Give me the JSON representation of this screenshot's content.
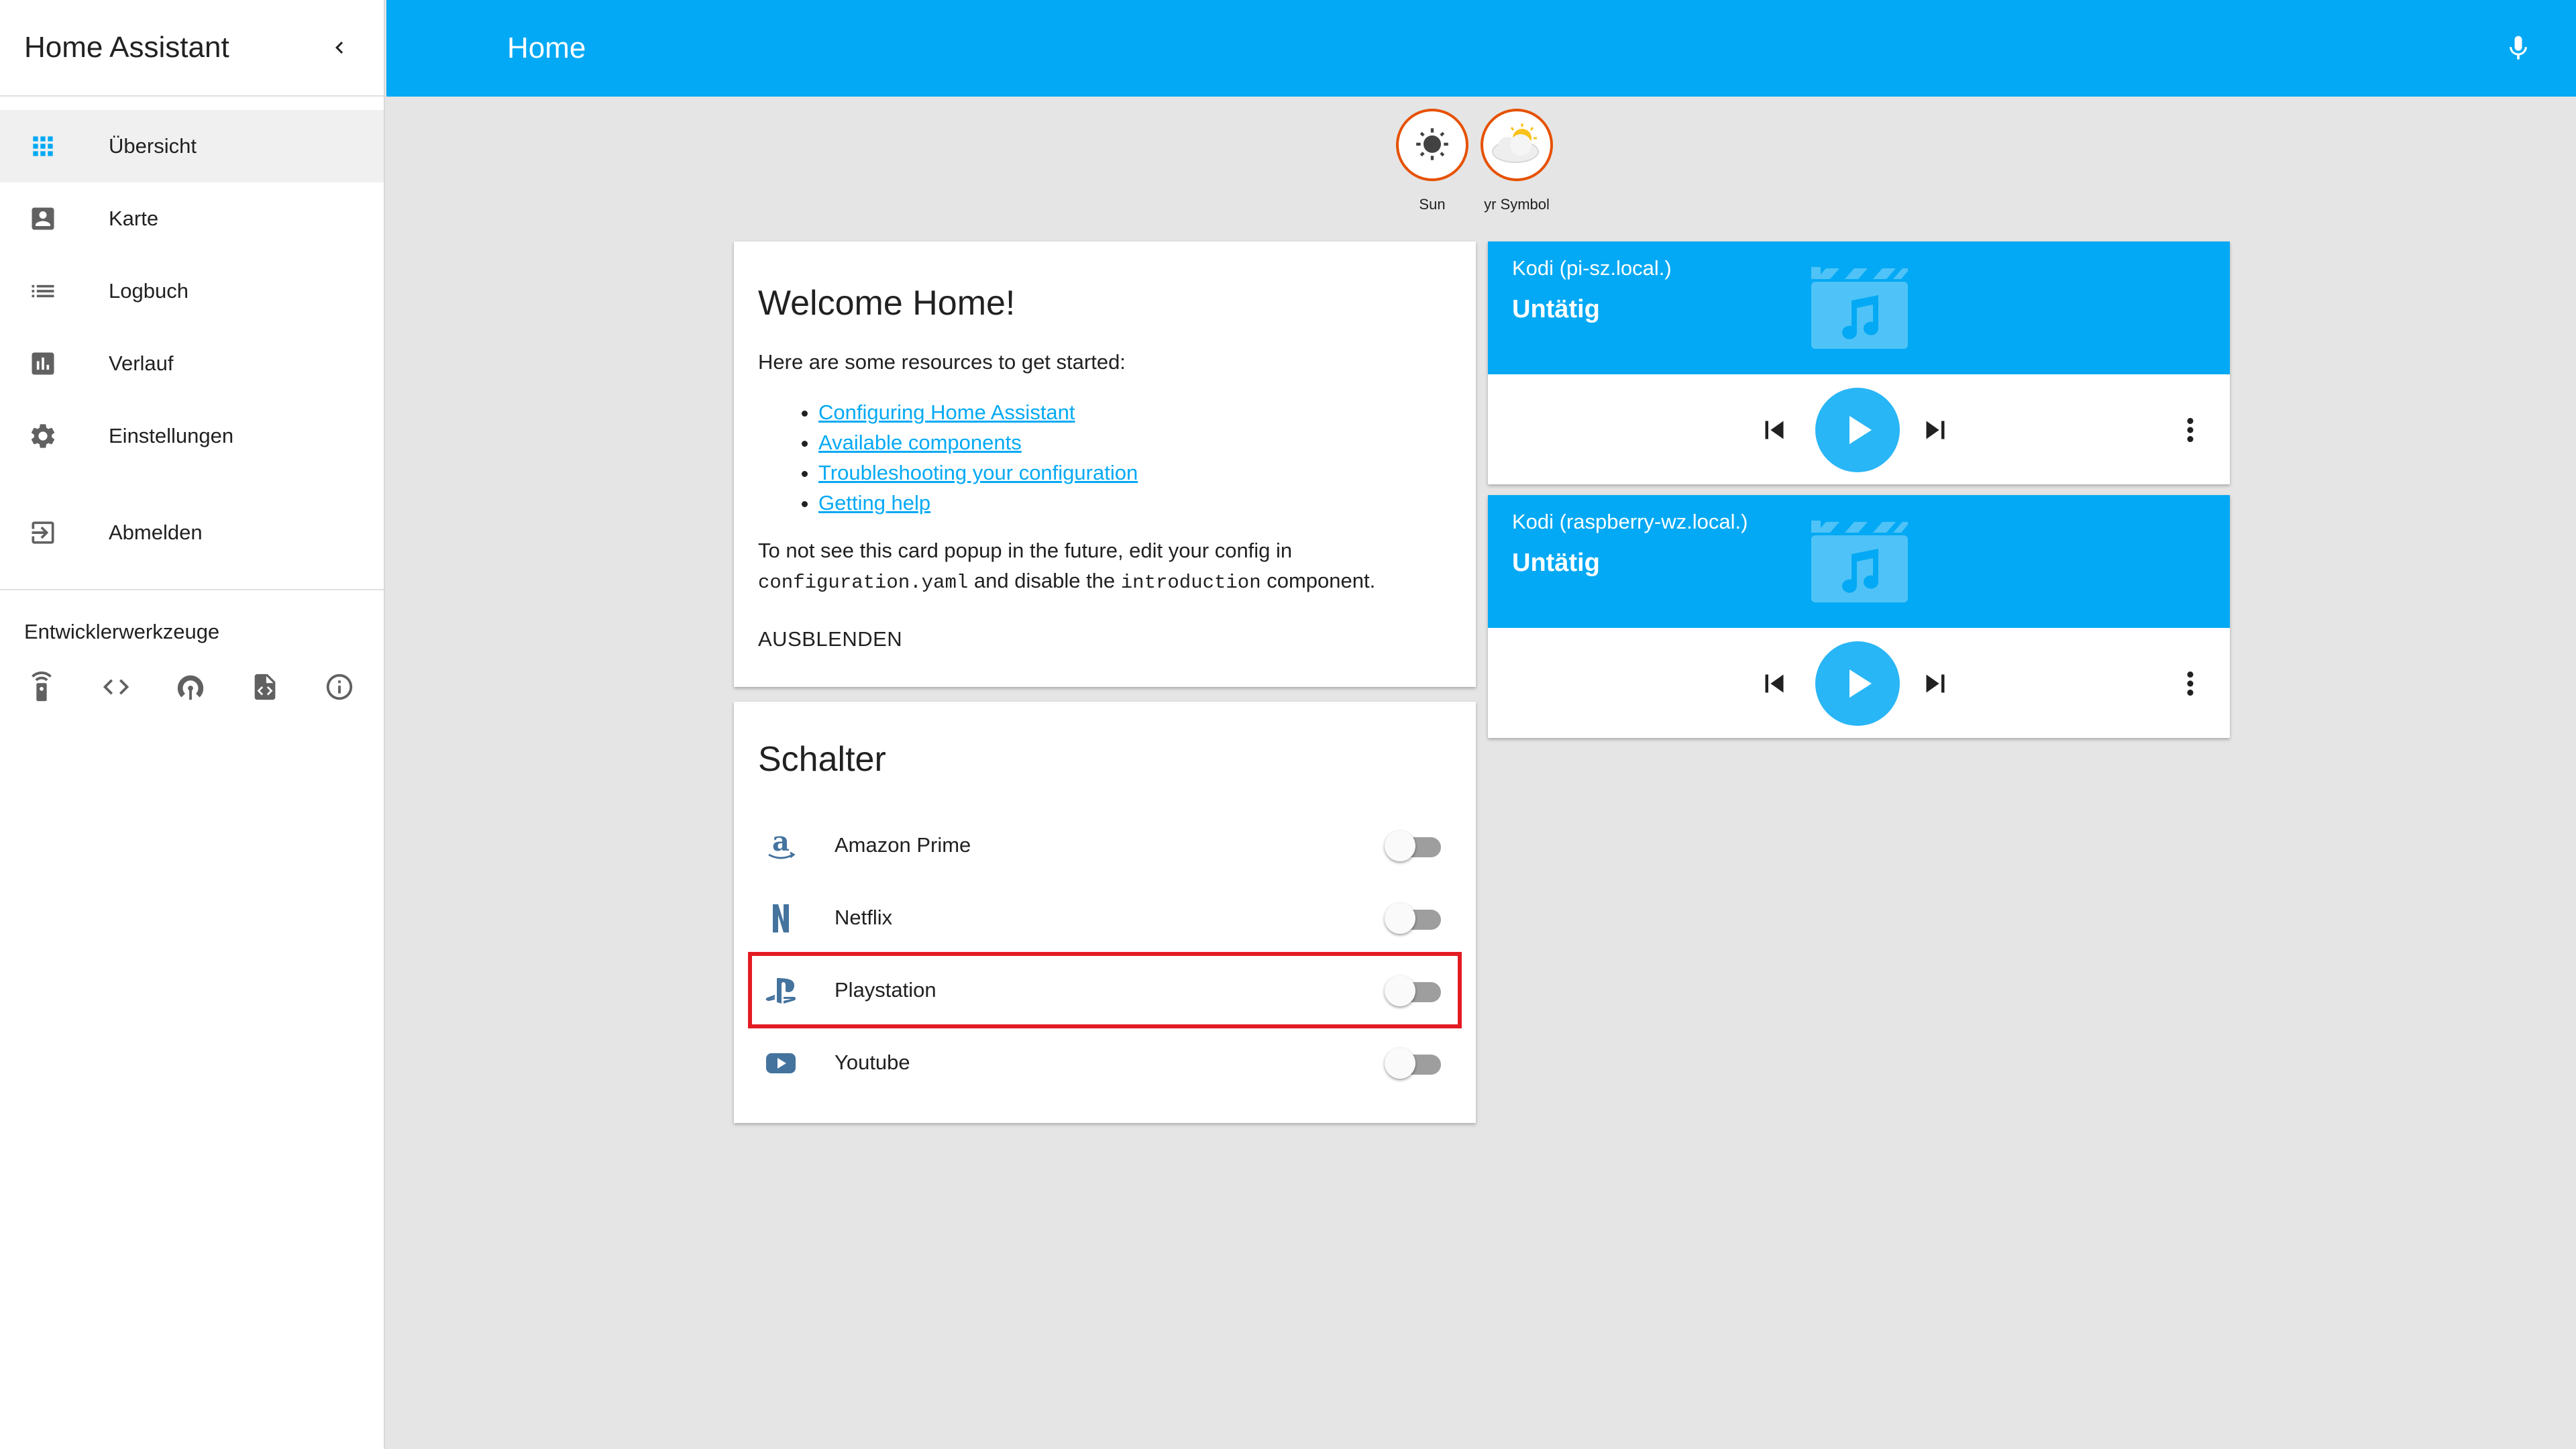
{
  "sidebar": {
    "title": "Home Assistant",
    "items": [
      {
        "label": "Übersicht",
        "icon": "apps-icon"
      },
      {
        "label": "Karte",
        "icon": "account-box-icon"
      },
      {
        "label": "Logbuch",
        "icon": "list-icon"
      },
      {
        "label": "Verlauf",
        "icon": "chart-icon"
      },
      {
        "label": "Einstellungen",
        "icon": "gear-icon"
      },
      {
        "label": "Abmelden",
        "icon": "exit-icon"
      }
    ],
    "dev_title": "Entwicklerwerkzeuge",
    "dev_tools": [
      "remote-icon",
      "code-icon",
      "broadcast-icon",
      "file-code-icon",
      "info-icon"
    ]
  },
  "header": {
    "title": "Home"
  },
  "badges": [
    {
      "label": "Sun",
      "icon": "sun-icon"
    },
    {
      "label": "yr Symbol",
      "icon": "partly-cloudy-icon"
    }
  ],
  "intro": {
    "title": "Welcome Home!",
    "lead": "Here are some resources to get started:",
    "links": [
      "Configuring Home Assistant",
      "Available components",
      "Troubleshooting your configuration",
      "Getting help"
    ],
    "note_1": "To not see this card popup in the future, edit your config in",
    "note_code_1": "configuration.yaml",
    "note_2": " and disable the ",
    "note_code_2": "introduction",
    "note_3": " component.",
    "hide_label": "AUSBLENDEN"
  },
  "switches": {
    "title": "Schalter",
    "items": [
      {
        "label": "Amazon Prime",
        "icon": "amazon-icon",
        "on": false
      },
      {
        "label": "Netflix",
        "icon": "netflix-icon",
        "on": false
      },
      {
        "label": "Playstation",
        "icon": "playstation-icon",
        "on": false,
        "highlighted": true
      },
      {
        "label": "Youtube",
        "icon": "youtube-icon",
        "on": false
      }
    ]
  },
  "media_players": [
    {
      "name": "Kodi (pi-sz.local.)",
      "state": "Untätig"
    },
    {
      "name": "Kodi (raspberry-wz.local.)",
      "state": "Untätig"
    }
  ],
  "colors": {
    "accent": "#03a9f4",
    "badge_border": "#e65100",
    "highlight": "#e31b23"
  }
}
